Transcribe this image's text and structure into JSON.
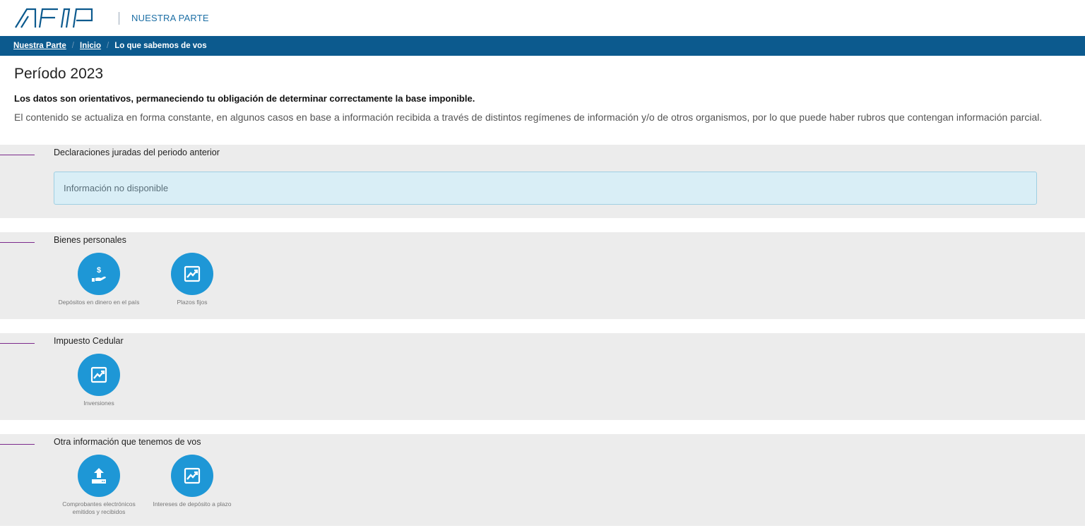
{
  "header": {
    "title": "NUESTRA PARTE"
  },
  "breadcrumb": {
    "items": [
      "Nuestra Parte",
      "Inicio"
    ],
    "current": "Lo que sabemos de vos"
  },
  "page": {
    "title": "Período 2023",
    "disclaimer": "Los datos son orientativos, permaneciendo tu obligación de determinar correctamente la base imponible.",
    "description": "El contenido se actualiza en forma constante, en algunos casos en base a información recibida a través de distintos regímenes de información y/o de otros organismos, por lo que puede haber rubros que contengan información parcial."
  },
  "sections": [
    {
      "title": "Declaraciones juradas del periodo anterior",
      "alert": "Información no disponible"
    },
    {
      "title": "Bienes personales",
      "tiles": [
        {
          "label": "Depósitos en dinero en el país",
          "icon": "money-hand-icon"
        },
        {
          "label": "Plazos fijos",
          "icon": "chart-line-icon"
        }
      ]
    },
    {
      "title": "Impuesto Cedular",
      "tiles": [
        {
          "label": "Inversiones",
          "icon": "chart-line-icon"
        }
      ]
    },
    {
      "title": "Otra información que tenemos de vos",
      "tiles": [
        {
          "label": "Comprobantes electrónicos emitidos y recibidos",
          "icon": "upload-icon"
        },
        {
          "label": "Intereses de depósito a plazo",
          "icon": "chart-line-icon"
        }
      ]
    }
  ],
  "colors": {
    "primary_bar": "#0c5a8e",
    "tile_blue": "#1e97d6",
    "section_bg": "#ececec",
    "accent_line": "#7c2a8c",
    "alert_bg": "#d9eef6"
  }
}
